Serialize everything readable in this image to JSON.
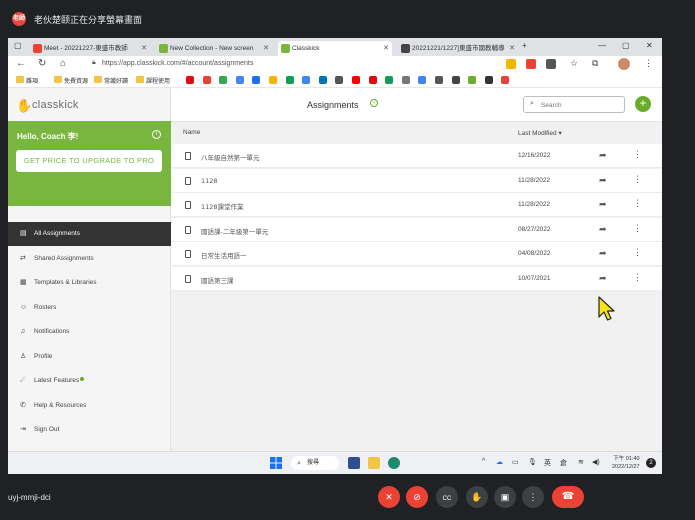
{
  "meet": {
    "presenter_badge": "老師",
    "presenter_text": "老伙楚颐正在分享螢幕畫面",
    "meeting_code": "uyj-mmji-dci",
    "controls": [
      {
        "name": "mic-off-icon",
        "glyph": "✕",
        "red": true
      },
      {
        "name": "camera-off-icon",
        "glyph": "⊘",
        "red": true
      },
      {
        "name": "captions-icon",
        "glyph": "CC",
        "red": false
      },
      {
        "name": "raise-hand-icon",
        "glyph": "✋",
        "red": false
      },
      {
        "name": "present-icon",
        "glyph": "▣",
        "red": false
      },
      {
        "name": "more-options-icon",
        "glyph": "⋮",
        "red": false
      }
    ],
    "end_call_glyph": "☎"
  },
  "browser": {
    "tabs": [
      {
        "title": "Meet - 20221227-東盛市教師",
        "icon_color": "#ea4335",
        "active": false
      },
      {
        "title": "New Collection - New screen",
        "icon_color": "#78b640",
        "active": false
      },
      {
        "title": "Classkick",
        "icon_color": "#78b640",
        "active": true
      },
      {
        "title": "20221221/1227]東盛市國教輔導",
        "icon_color": "#444444",
        "active": false
      }
    ],
    "url": "https://app.classkick.com/#/account/assignments",
    "bookmarks": [
      {
        "label": "雜項"
      },
      {
        "label": "免費資源"
      },
      {
        "label": "常識好讀"
      },
      {
        "label": "課程使用"
      }
    ],
    "bookmark_icon_colors": [
      "#e50914",
      "#ea4335",
      "#34a853",
      "#4285f4",
      "#1a73e8",
      "#f4b400",
      "#0f9d58",
      "#4285f4",
      "#0077b5",
      "#555555",
      "#ff0000",
      "#e50914",
      "#0f9d58",
      "#777777",
      "#4285f4",
      "#555555",
      "#444444",
      "#6bab2b",
      "#333333",
      "#ea4335"
    ]
  },
  "app": {
    "brand": "classkick",
    "greeting": "Hello, Coach 李!",
    "upgrade_label": "GET PRICE TO UPGRADE TO PRO",
    "nav": [
      {
        "label": "All Assignments",
        "icon": "▤",
        "active": true,
        "dot": false
      },
      {
        "label": "Shared Assignments",
        "icon": "⇄",
        "active": false,
        "dot": false
      },
      {
        "label": "Templates & Libraries",
        "icon": "▦",
        "active": false,
        "dot": false
      },
      {
        "label": "Rosters",
        "icon": "☺",
        "active": false,
        "dot": false
      },
      {
        "label": "Notifications",
        "icon": "♫",
        "active": false,
        "dot": false
      },
      {
        "label": "Profile",
        "icon": "♙",
        "active": false,
        "dot": false
      },
      {
        "label": "Latest Features",
        "icon": "☄",
        "active": false,
        "dot": true
      },
      {
        "label": "Help & Resources",
        "icon": "✆",
        "active": false,
        "dot": false
      },
      {
        "label": "Sign Out",
        "icon": "⇥",
        "active": false,
        "dot": false
      }
    ],
    "page_title": "Assignments",
    "search_placeholder": "Search",
    "columns": {
      "name": "Name",
      "modified": "Last Modified ▾"
    },
    "assignments": [
      {
        "name": "八年級自然第一單元",
        "date": "12/16/2022"
      },
      {
        "name": "1128",
        "date": "11/28/2022"
      },
      {
        "name": "1128課堂作業",
        "date": "11/28/2022"
      },
      {
        "name": "國語課-二年級第一單元",
        "date": "08/27/2022"
      },
      {
        "name": "日常生活用語一",
        "date": "04/08/2022"
      },
      {
        "name": "國語第三課",
        "date": "10/07/2021"
      }
    ]
  },
  "taskbar": {
    "search_label": "搜尋",
    "ime_label": "英",
    "ime2_label": "倉",
    "time": "下午 01:40",
    "date": "2022/12/27",
    "notification_count": "2"
  }
}
